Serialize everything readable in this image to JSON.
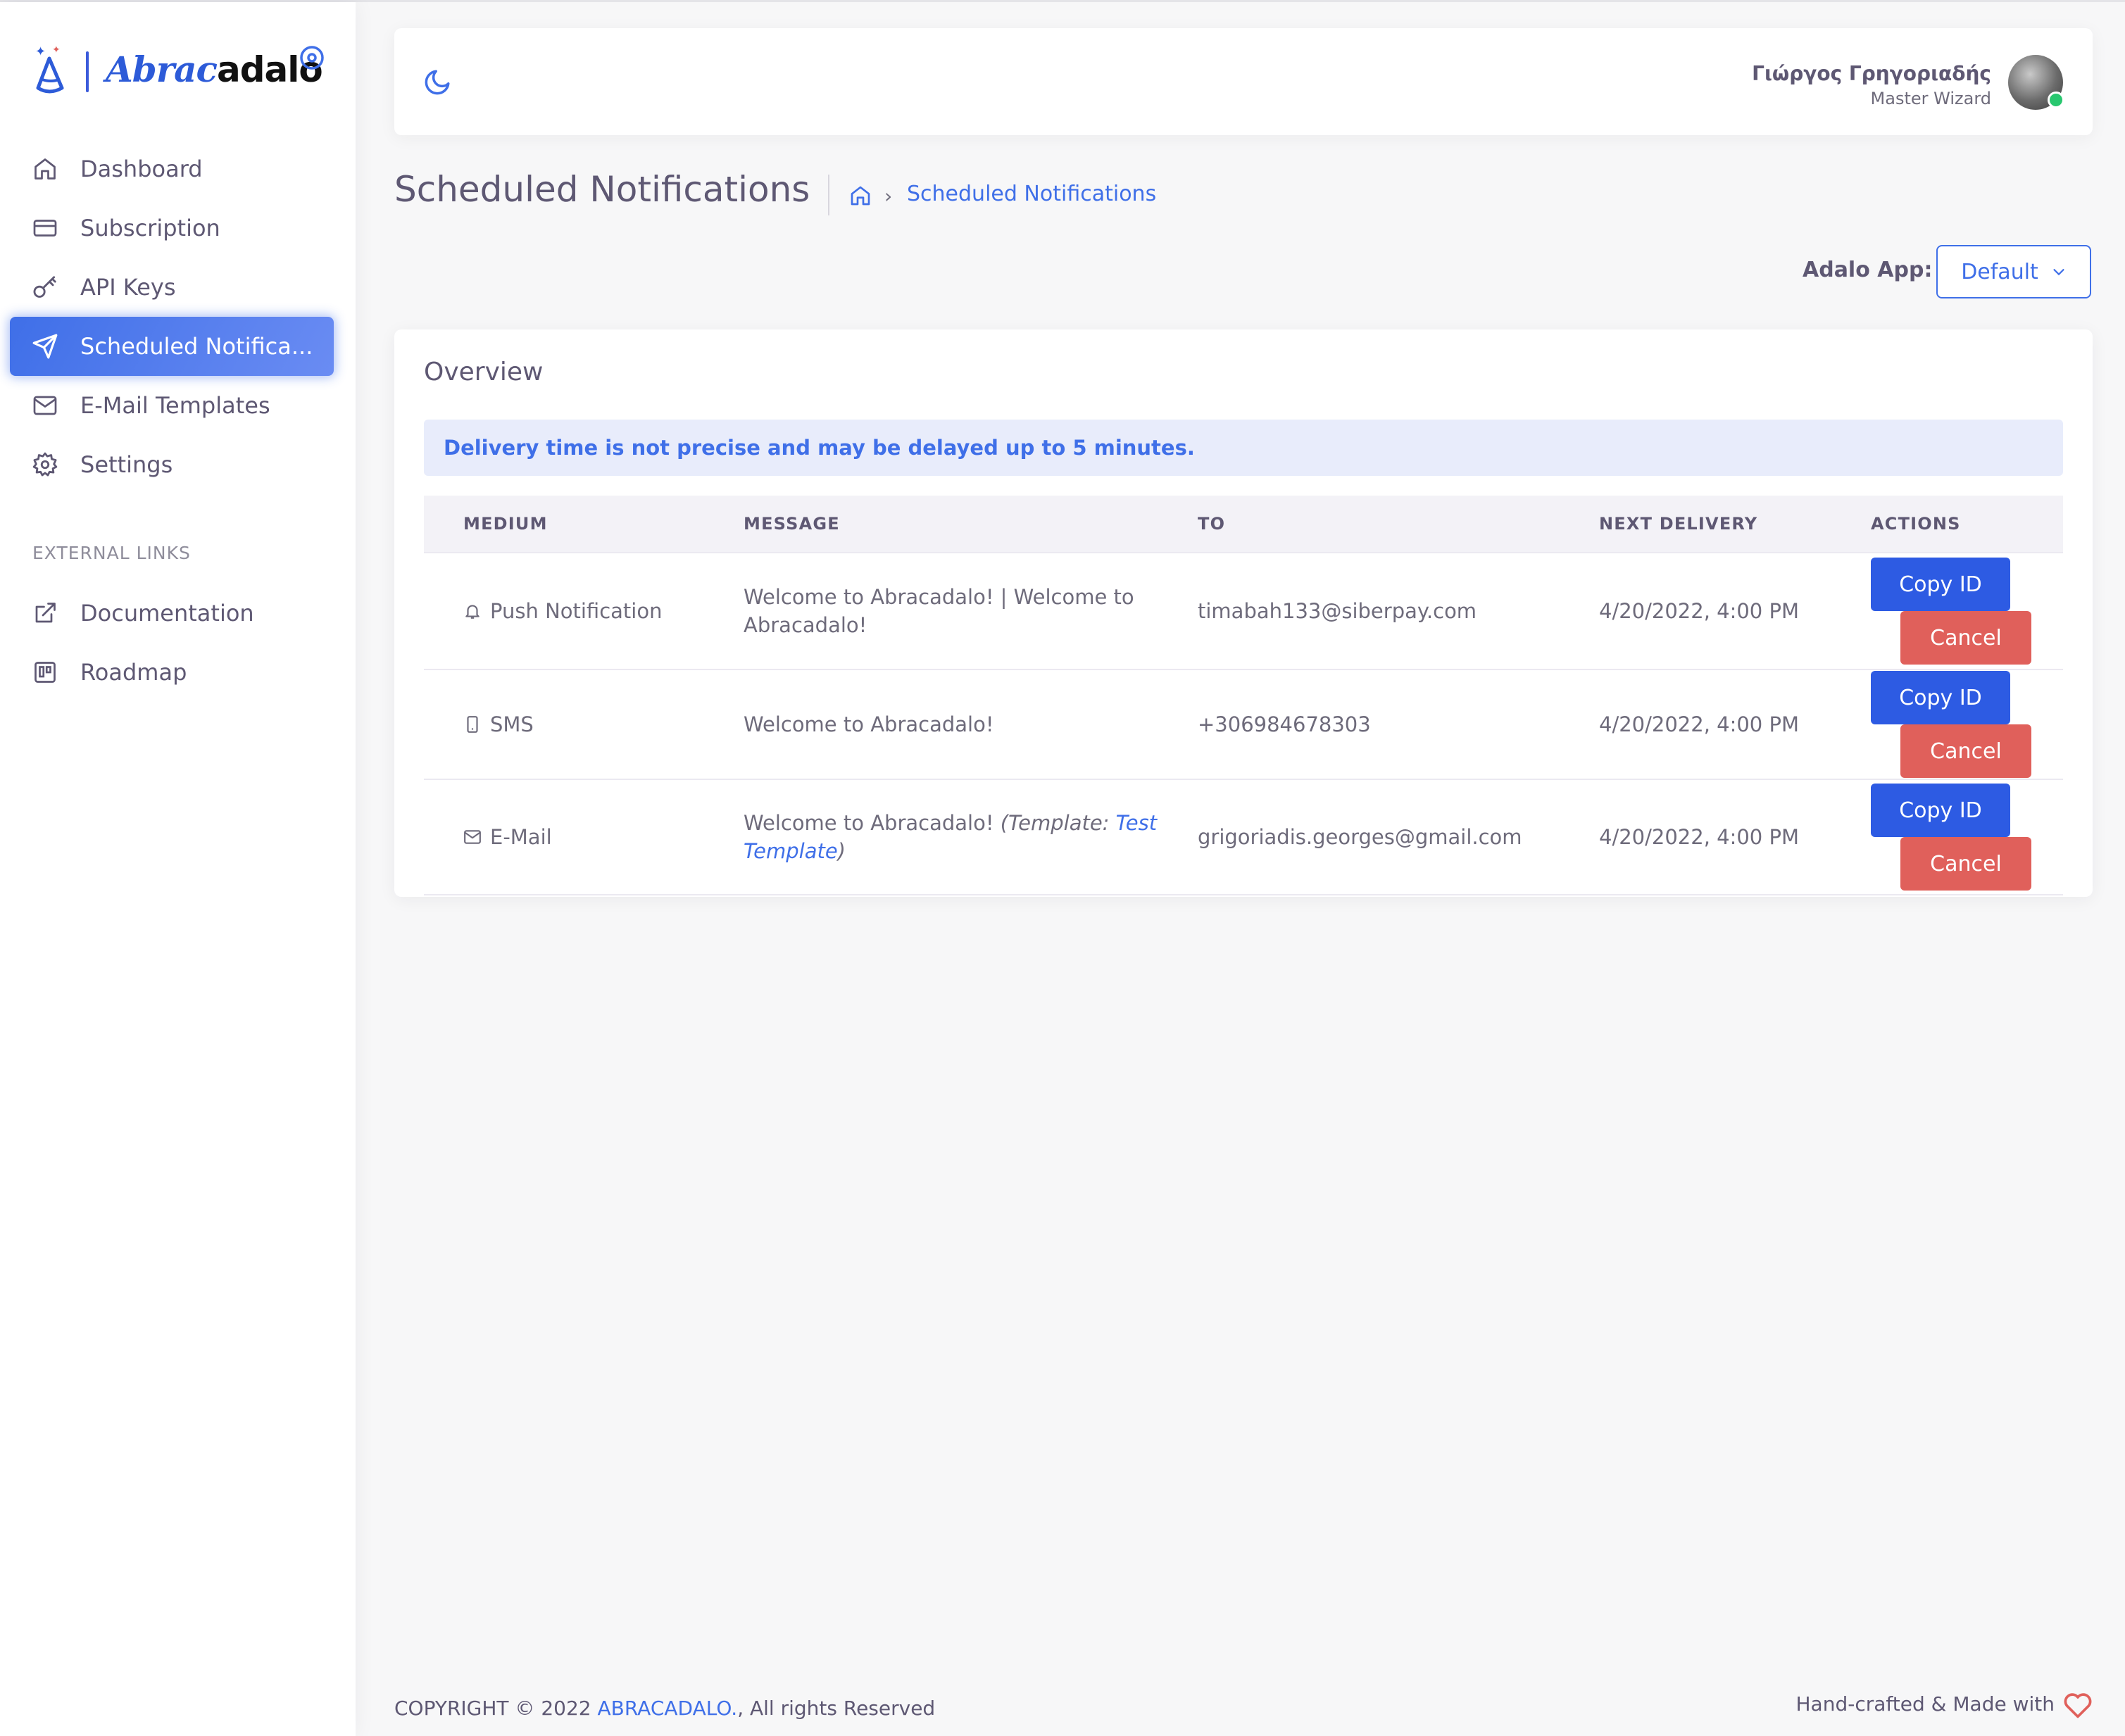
{
  "brand": {
    "name_part1": "Abrac",
    "name_part2": "adalo"
  },
  "sidebar": {
    "items": [
      {
        "label": "Dashboard",
        "icon": "home-icon"
      },
      {
        "label": "Subscription",
        "icon": "credit-card-icon"
      },
      {
        "label": "API Keys",
        "icon": "key-icon"
      },
      {
        "label": "Scheduled Notifica...",
        "icon": "send-icon",
        "active": true
      },
      {
        "label": "E-Mail Templates",
        "icon": "mail-icon"
      },
      {
        "label": "Settings",
        "icon": "gear-icon"
      }
    ],
    "section_title": "EXTERNAL LINKS",
    "external": [
      {
        "label": "Documentation",
        "icon": "external-link-icon"
      },
      {
        "label": "Roadmap",
        "icon": "trello-icon"
      }
    ]
  },
  "header": {
    "user_name": "Γιώργος Γρηγοριαδής",
    "user_role": "Master Wizard"
  },
  "page": {
    "title": "Scheduled Notifications",
    "breadcrumb_current": "Scheduled Notifications"
  },
  "app_selector": {
    "label": "Adalo App:",
    "value": "Default"
  },
  "card": {
    "title": "Overview",
    "alert": "Delivery time is not precise and may be delayed up to 5 minutes.",
    "columns": [
      "MEDIUM",
      "MESSAGE",
      "TO",
      "NEXT DELIVERY",
      "ACTIONS"
    ],
    "rows": [
      {
        "medium": "Push Notification",
        "medium_icon": "bell-icon",
        "message": "Welcome to Abracadalo! | Welcome to Abracadalo!",
        "to": "timabah133@siberpay.com",
        "next_delivery": "4/20/2022, 4:00 PM"
      },
      {
        "medium": "SMS",
        "medium_icon": "smartphone-icon",
        "message": "Welcome to Abracadalo!",
        "to": "+306984678303",
        "next_delivery": "4/20/2022, 4:00 PM"
      },
      {
        "medium": "E-Mail",
        "medium_icon": "mail-icon",
        "message": "Welcome to Abracadalo!",
        "template_prefix": "(Template: ",
        "template_name": "Test Template",
        "template_suffix": ")",
        "to": "grigoriadis.georges@gmail.com",
        "next_delivery": "4/20/2022, 4:00 PM"
      }
    ],
    "copy_label": "Copy ID",
    "cancel_label": "Cancel"
  },
  "footer": {
    "copyright_prefix": "COPYRIGHT © 2022 ",
    "copyright_link": "ABRACADALO.",
    "copyright_suffix": ", All rights Reserved",
    "made_with": "Hand-crafted & Made with"
  },
  "colors": {
    "primary": "#3f6fe8",
    "danger": "#e0605b",
    "text": "#5e5873",
    "background": "#f7f7f8"
  }
}
